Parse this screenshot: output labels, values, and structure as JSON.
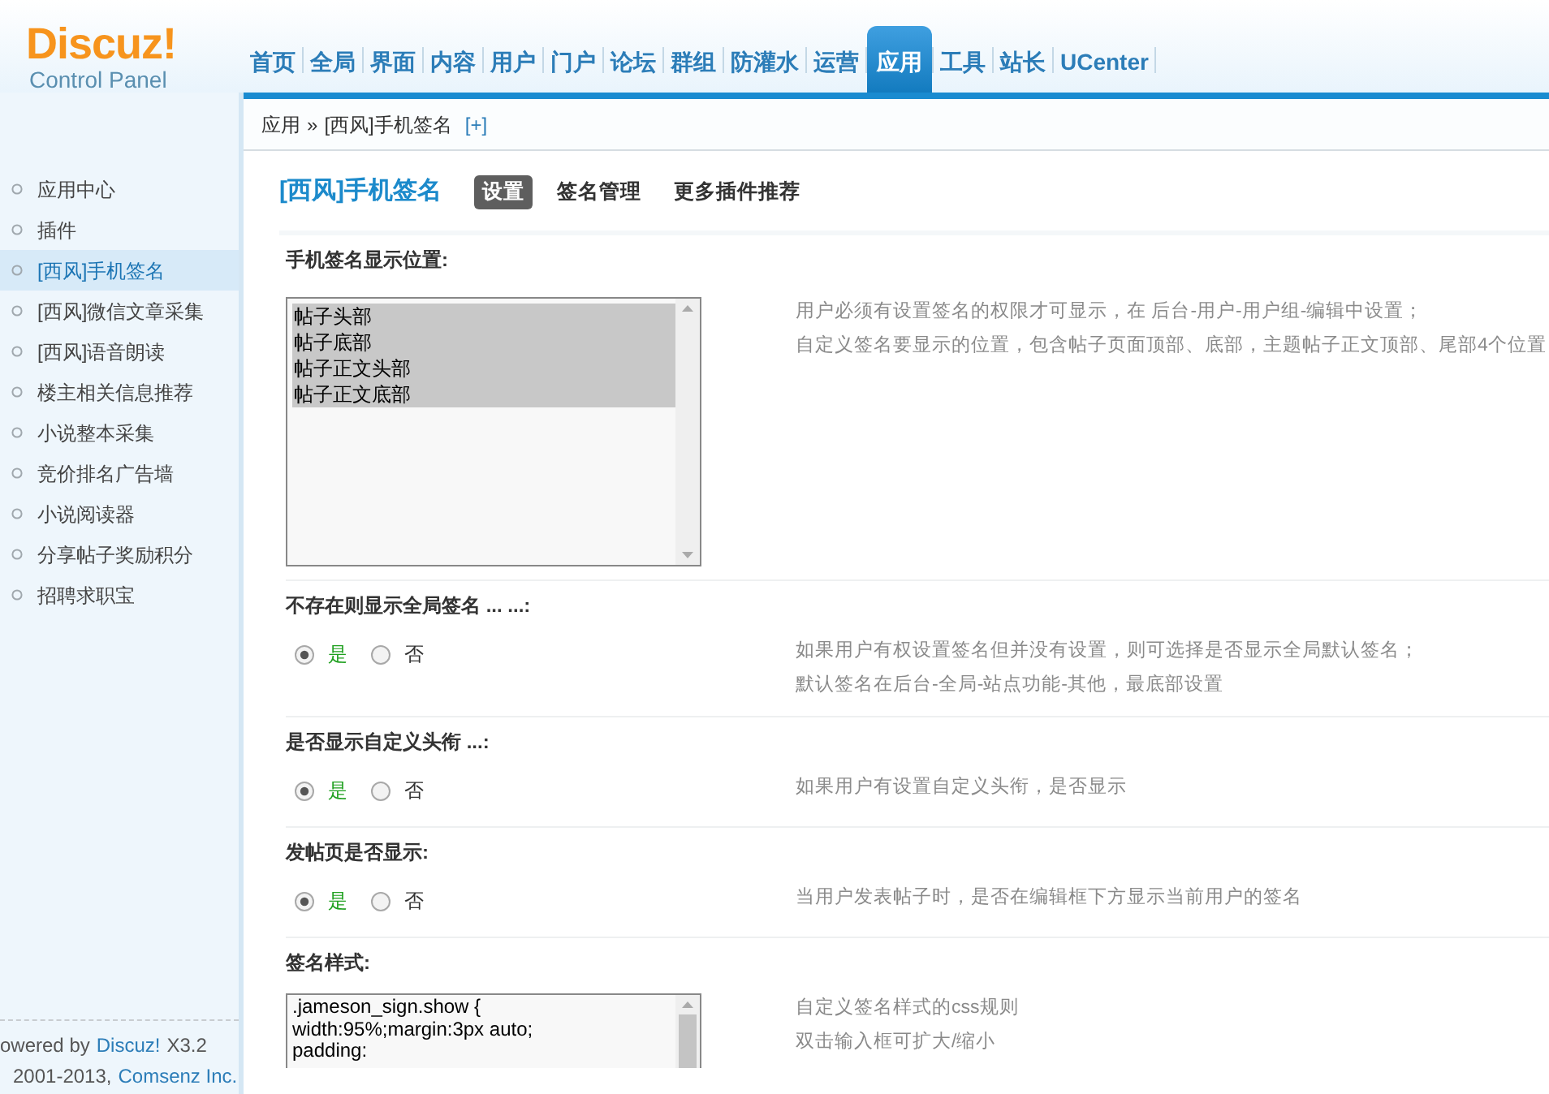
{
  "logo": {
    "name": "Discuz!",
    "subtitle": "Control Panel"
  },
  "nav": [
    {
      "label": "首页",
      "selected": false
    },
    {
      "label": "全局",
      "selected": false
    },
    {
      "label": "界面",
      "selected": false
    },
    {
      "label": "内容",
      "selected": false
    },
    {
      "label": "用户",
      "selected": false
    },
    {
      "label": "门户",
      "selected": false
    },
    {
      "label": "论坛",
      "selected": false
    },
    {
      "label": "群组",
      "selected": false
    },
    {
      "label": "防灌水",
      "selected": false
    },
    {
      "label": "运营",
      "selected": false
    },
    {
      "label": "应用",
      "selected": true
    },
    {
      "label": "工具",
      "selected": false
    },
    {
      "label": "站长",
      "selected": false
    },
    {
      "label": "UCenter",
      "selected": false
    }
  ],
  "breadcrumb": {
    "items": [
      "应用",
      "[西风]手机签名"
    ],
    "separator": "»",
    "add": "[+]"
  },
  "sidebar": {
    "items": [
      {
        "label": "应用中心",
        "selected": false
      },
      {
        "label": "插件",
        "selected": false
      },
      {
        "label": "[西风]手机签名",
        "selected": true
      },
      {
        "label": "[西风]微信文章采集",
        "selected": false
      },
      {
        "label": "[西风]语音朗读",
        "selected": false
      },
      {
        "label": "楼主相关信息推荐",
        "selected": false
      },
      {
        "label": "小说整本采集",
        "selected": false
      },
      {
        "label": "竞价排名广告墙",
        "selected": false
      },
      {
        "label": "小说阅读器",
        "selected": false
      },
      {
        "label": "分享帖子奖励积分",
        "selected": false
      },
      {
        "label": "招聘求职宝",
        "selected": false
      }
    ]
  },
  "footer": {
    "powered": "owered by",
    "product": "Discuz!",
    "version": "X3.2",
    "copyright": "2001-2013,",
    "company": "Comsenz Inc."
  },
  "plugin": {
    "title": "[西风]手机签名",
    "tabs": [
      {
        "label": "设置",
        "selected": true
      },
      {
        "label": "签名管理",
        "selected": false
      },
      {
        "label": "更多插件推荐",
        "selected": false
      }
    ]
  },
  "settings": [
    {
      "kind": "multiselect",
      "label": "手机签名显示位置:",
      "options": [
        {
          "label": "帖子头部",
          "selected": true
        },
        {
          "label": "帖子底部",
          "selected": true
        },
        {
          "label": "帖子正文头部",
          "selected": true
        },
        {
          "label": "帖子正文底部",
          "selected": true
        }
      ],
      "description": [
        "用户必须有设置签名的权限才可显示，在 后台-用户-用户组-编辑中设置；",
        "自定义签名要显示的位置，包含帖子页面顶部、底部，主题帖子正文顶部、尾部4个位置"
      ]
    },
    {
      "kind": "radio",
      "label": "不存在则显示全局签名 ... ...:",
      "options": [
        {
          "label": "是",
          "selected": true
        },
        {
          "label": "否",
          "selected": false
        }
      ],
      "description": [
        "如果用户有权设置签名但并没有设置，则可选择是否显示全局默认签名；",
        "默认签名在后台-全局-站点功能-其他，最底部设置"
      ]
    },
    {
      "kind": "radio",
      "label": "是否显示自定义头衔 ...:",
      "options": [
        {
          "label": "是",
          "selected": true
        },
        {
          "label": "否",
          "selected": false
        }
      ],
      "description": [
        "如果用户有设置自定义头衔，是否显示"
      ]
    },
    {
      "kind": "radio",
      "label": "发帖页是否显示:",
      "options": [
        {
          "label": "是",
          "selected": true
        },
        {
          "label": "否",
          "selected": false
        }
      ],
      "description": [
        "当用户发表帖子时，是否在编辑框下方显示当前用户的签名"
      ]
    },
    {
      "kind": "code",
      "label": "签名样式:",
      "lines": [
        ".jameson_sign.show {",
        "width:95%;margin:3px auto;",
        "padding:"
      ],
      "description": [
        "自定义签名样式的css规则",
        "双击输入框可扩大/缩小"
      ]
    }
  ]
}
